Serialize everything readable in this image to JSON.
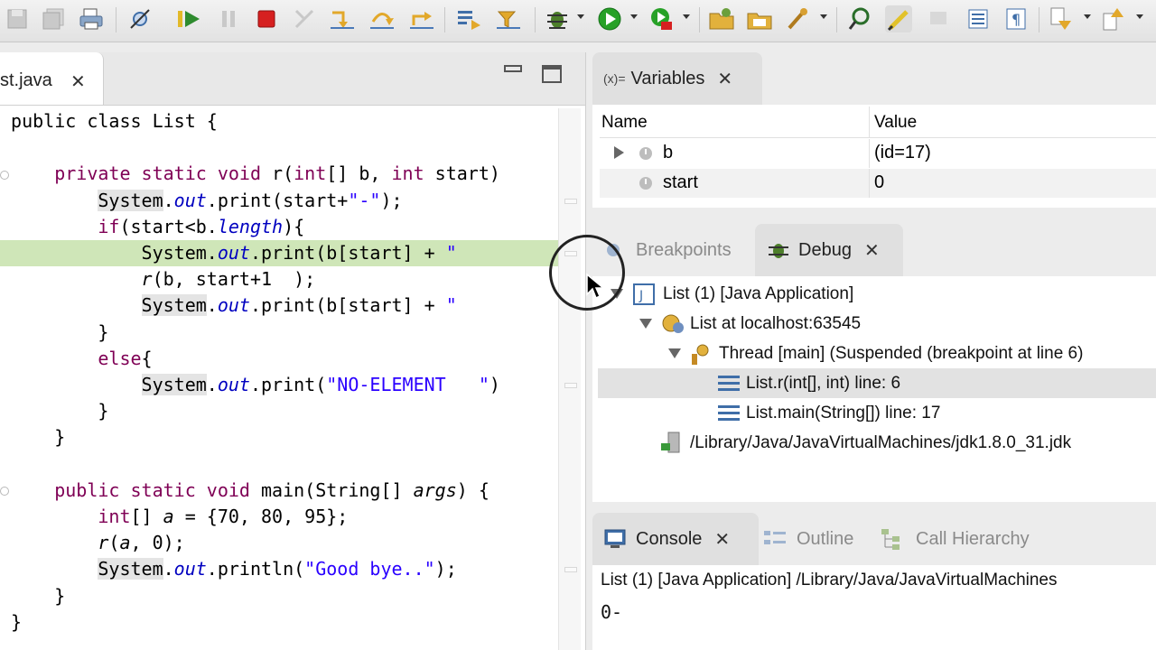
{
  "toolbar": {
    "icons": [
      "save-icon",
      "save-all-icon",
      "print-icon",
      "skip-breakpoints-icon",
      "resume-icon",
      "suspend-icon",
      "terminate-icon",
      "disconnect-icon",
      "step-into-icon",
      "step-over-icon",
      "step-return-icon",
      "drop-to-frame-icon",
      "use-step-filters-icon",
      "debug-icon",
      "run-icon",
      "run-external-tool-icon",
      "new-java-project-icon",
      "open-type-icon",
      "open-task-icon",
      "search-icon",
      "toggle-mark-occurrences-icon",
      "toggle-block-selection-icon",
      "show-whitespace-icon",
      "next-annotation-icon",
      "previous-annotation-icon"
    ],
    "colors": {
      "resume": "#2e8b2e",
      "terminate": "#d62020",
      "run": "#27a127",
      "debug": "#4d7f2a"
    }
  },
  "editor": {
    "tab_label": "st.java",
    "close_label": "✕"
  },
  "code": [
    {
      "segments": [
        {
          "t": "public class List {",
          "c": "plain"
        }
      ]
    },
    {
      "segments": [
        {
          "t": "",
          "c": "plain"
        }
      ]
    },
    {
      "segments": [
        {
          "t": "    ",
          "c": "plain"
        },
        {
          "t": "private static void",
          "c": "kw"
        },
        {
          "t": " r(",
          "c": "plain"
        },
        {
          "t": "int",
          "c": "kw"
        },
        {
          "t": "[] b, ",
          "c": "plain"
        },
        {
          "t": "int",
          "c": "kw"
        },
        {
          "t": " start)",
          "c": "plain"
        }
      ]
    },
    {
      "segments": [
        {
          "t": "        ",
          "c": "plain"
        },
        {
          "t": "System",
          "c": "sys"
        },
        {
          "t": ".",
          "c": "plain"
        },
        {
          "t": "out",
          "c": "fld"
        },
        {
          "t": ".print(start+",
          "c": "plain"
        },
        {
          "t": "\"-\"",
          "c": "str"
        },
        {
          "t": ");",
          "c": "plain"
        }
      ]
    },
    {
      "segments": [
        {
          "t": "        ",
          "c": "plain"
        },
        {
          "t": "if",
          "c": "kw"
        },
        {
          "t": "(start<b.",
          "c": "plain"
        },
        {
          "t": "length",
          "c": "fld"
        },
        {
          "t": "){",
          "c": "plain"
        }
      ]
    },
    {
      "segments": [
        {
          "t": "            System.",
          "c": "plain"
        },
        {
          "t": "out",
          "c": "fld"
        },
        {
          "t": ".print(b[start] + ",
          "c": "plain"
        },
        {
          "t": "\" ",
          "c": "str"
        }
      ],
      "highlight": true
    },
    {
      "segments": [
        {
          "t": "            ",
          "c": "plain"
        },
        {
          "t": "r",
          "c": "it"
        },
        {
          "t": "(b, start+1  );",
          "c": "plain"
        }
      ]
    },
    {
      "segments": [
        {
          "t": "            ",
          "c": "plain"
        },
        {
          "t": "System",
          "c": "sys"
        },
        {
          "t": ".",
          "c": "plain"
        },
        {
          "t": "out",
          "c": "fld"
        },
        {
          "t": ".print(b[start] + ",
          "c": "plain"
        },
        {
          "t": "\" ",
          "c": "str"
        }
      ]
    },
    {
      "segments": [
        {
          "t": "        }",
          "c": "plain"
        }
      ]
    },
    {
      "segments": [
        {
          "t": "        ",
          "c": "plain"
        },
        {
          "t": "else",
          "c": "kw"
        },
        {
          "t": "{",
          "c": "plain"
        }
      ]
    },
    {
      "segments": [
        {
          "t": "            ",
          "c": "plain"
        },
        {
          "t": "System",
          "c": "sys"
        },
        {
          "t": ".",
          "c": "plain"
        },
        {
          "t": "out",
          "c": "fld"
        },
        {
          "t": ".print(",
          "c": "plain"
        },
        {
          "t": "\"NO-ELEMENT   \"",
          "c": "str"
        },
        {
          "t": ")",
          "c": "plain"
        }
      ]
    },
    {
      "segments": [
        {
          "t": "        }",
          "c": "plain"
        }
      ]
    },
    {
      "segments": [
        {
          "t": "    }",
          "c": "plain"
        }
      ]
    },
    {
      "segments": [
        {
          "t": "",
          "c": "plain"
        }
      ]
    },
    {
      "segments": [
        {
          "t": "    ",
          "c": "plain"
        },
        {
          "t": "public static void",
          "c": "kw"
        },
        {
          "t": " main(String[] ",
          "c": "plain"
        },
        {
          "t": "args",
          "c": "it"
        },
        {
          "t": ") {",
          "c": "plain"
        }
      ]
    },
    {
      "segments": [
        {
          "t": "        ",
          "c": "plain"
        },
        {
          "t": "int",
          "c": "kw"
        },
        {
          "t": "[] ",
          "c": "plain"
        },
        {
          "t": "a",
          "c": "it"
        },
        {
          "t": " = {70, 80, 95};",
          "c": "plain"
        }
      ]
    },
    {
      "segments": [
        {
          "t": "        ",
          "c": "plain"
        },
        {
          "t": "r",
          "c": "it"
        },
        {
          "t": "(",
          "c": "plain"
        },
        {
          "t": "a",
          "c": "it"
        },
        {
          "t": ", 0);",
          "c": "plain"
        }
      ]
    },
    {
      "segments": [
        {
          "t": "        ",
          "c": "plain"
        },
        {
          "t": "System",
          "c": "sys"
        },
        {
          "t": ".",
          "c": "plain"
        },
        {
          "t": "out",
          "c": "fld"
        },
        {
          "t": ".println(",
          "c": "plain"
        },
        {
          "t": "\"Good bye..\"",
          "c": "str"
        },
        {
          "t": ");",
          "c": "plain"
        }
      ]
    },
    {
      "segments": [
        {
          "t": "    }",
          "c": "plain"
        }
      ]
    },
    {
      "segments": [
        {
          "t": "}",
          "c": "plain"
        }
      ]
    }
  ],
  "variables": {
    "tab_prefix": "(x)=",
    "tab_label": "Variables",
    "close": "✕",
    "col_name": "Name",
    "col_value": "Value",
    "rows": [
      {
        "name": "b",
        "value": "(id=17)",
        "expandable": true
      },
      {
        "name": "start",
        "value": "0",
        "expandable": false
      }
    ]
  },
  "debug": {
    "breakpoints_label": "Breakpoints",
    "debug_label": "Debug",
    "close": "✕",
    "tree": [
      {
        "label": "List (1) [Java Application]",
        "icon": "java-app-icon",
        "expanded": true
      },
      {
        "label": "List at localhost:63545",
        "icon": "debug-target-icon",
        "expanded": true
      },
      {
        "label": "Thread [main] (Suspended (breakpoint at line 6)",
        "icon": "thread-icon",
        "expanded": true
      },
      {
        "label": "List.r(int[], int) line: 6",
        "icon": "stack-frame-icon",
        "selected": true
      },
      {
        "label": "List.main(String[]) line: 17",
        "icon": "stack-frame-icon"
      },
      {
        "label": "/Library/Java/JavaVirtualMachines/jdk1.8.0_31.jdk",
        "icon": "process-icon"
      }
    ]
  },
  "console": {
    "console_label": "Console",
    "close": "✕",
    "outline_label": "Outline",
    "call_hierarchy_label": "Call Hierarchy",
    "header": "List (1) [Java Application] /Library/Java/JavaVirtualMachines",
    "output": "0-"
  }
}
